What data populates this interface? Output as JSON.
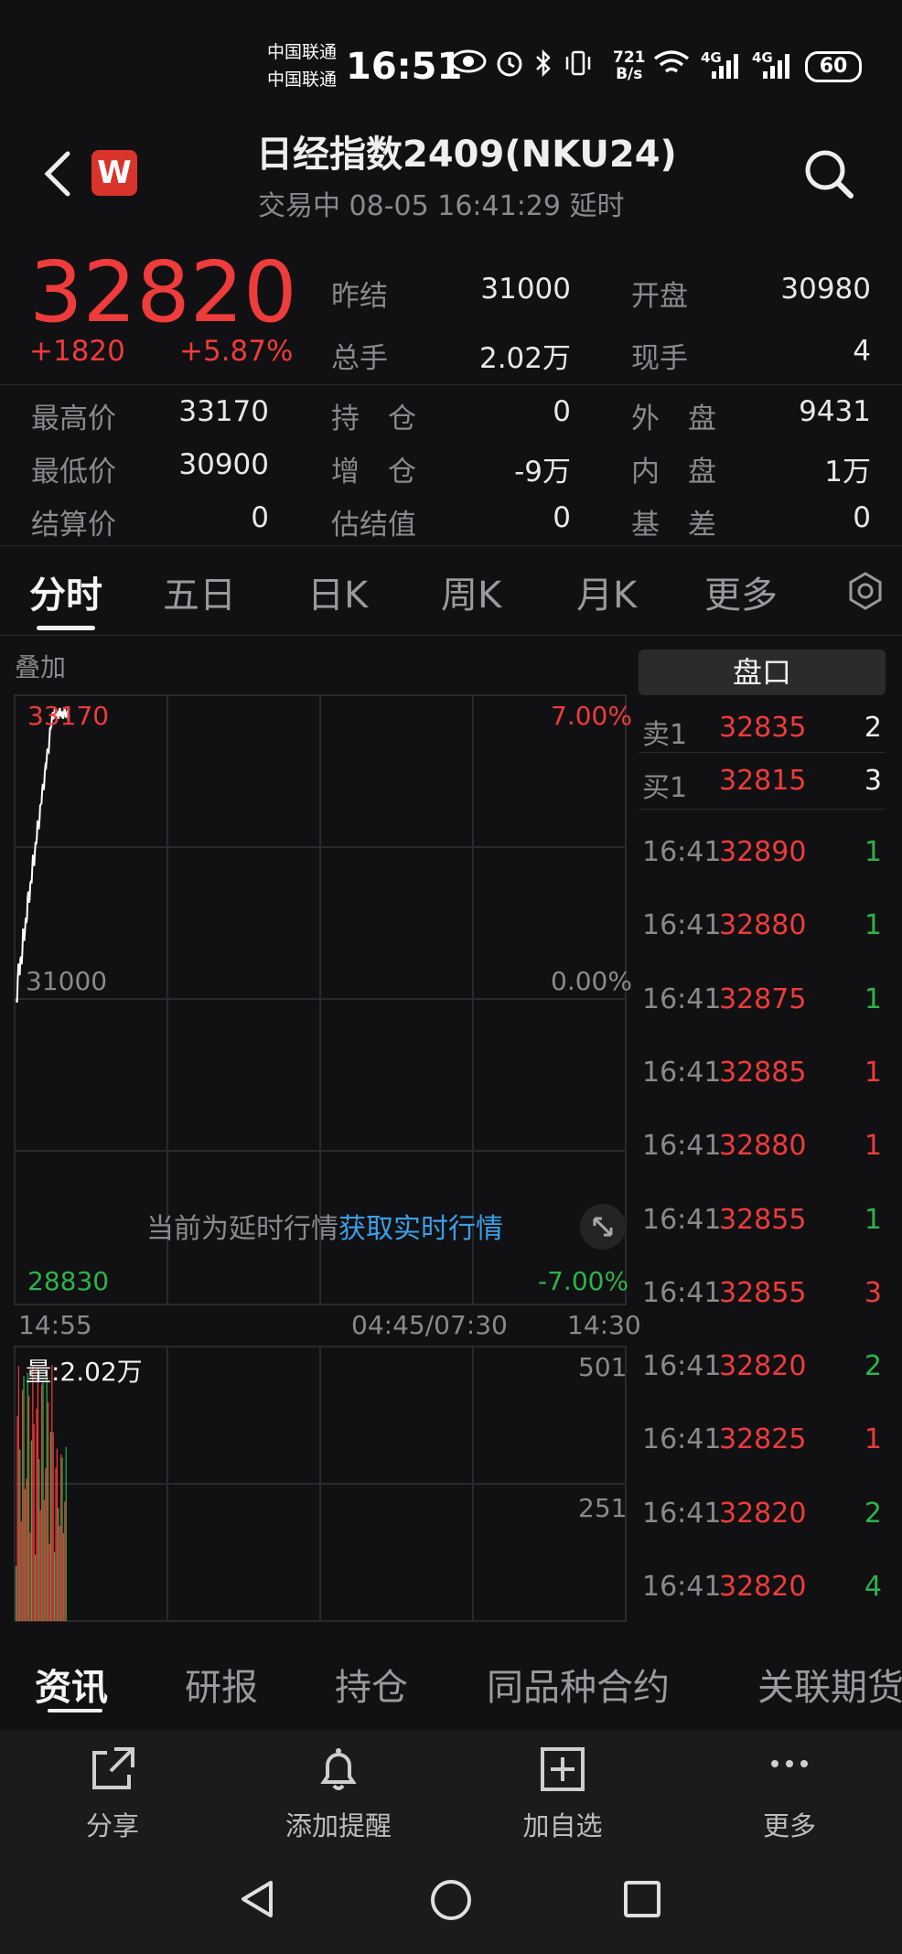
{
  "status_bar": {
    "carrier1": "中国联通",
    "carrier2": "中国联通",
    "time": "16:51",
    "net_speed_top": "721",
    "net_speed_bottom": "B/s",
    "sig1": "4G",
    "sig2": "4G",
    "battery": "60"
  },
  "header": {
    "title": "日经指数2409(NKU24)",
    "subtitle": "交易中 08-05 16:41:29 延时",
    "logo": "W"
  },
  "quote": {
    "price": "32820",
    "change": "+1820",
    "change_pct": "+5.87%",
    "fields": [
      {
        "label": "昨结",
        "value": "31000"
      },
      {
        "label": "开盘",
        "value": "30980"
      },
      {
        "label": "总手",
        "value": "2.02万"
      },
      {
        "label": "现手",
        "value": "4"
      },
      {
        "label": "最高价",
        "value": "33170"
      },
      {
        "label": "持　仓",
        "value": "0"
      },
      {
        "label": "外　盘",
        "value": "9431"
      },
      {
        "label": "最低价",
        "value": "30900"
      },
      {
        "label": "增　仓",
        "value": "-9万"
      },
      {
        "label": "内　盘",
        "value": "1万"
      },
      {
        "label": "结算价",
        "value": "0"
      },
      {
        "label": "估结值",
        "value": "0"
      },
      {
        "label": "基　差",
        "value": "0"
      }
    ]
  },
  "tabs": [
    "分时",
    "五日",
    "日K",
    "周K",
    "月K",
    "更多"
  ],
  "chart": {
    "overlay_label": "叠加",
    "y_top": "33170",
    "y_mid": "31000",
    "y_bottom": "28830",
    "pct_top": "7.00%",
    "pct_mid": "0.00%",
    "pct_bottom": "-7.00%",
    "x_start": "14:55",
    "x_mid": "04:45/07:30",
    "x_end": "14:30",
    "notice_text": "当前为延时行情",
    "notice_link": "获取实时行情",
    "volume_label": "量:2.02万",
    "vol_top": "501",
    "vol_mid": "251",
    "colors": {
      "up": "#ee3b3b",
      "down": "#2fb34a",
      "line": "#ffffff"
    }
  },
  "chart_data": {
    "type": "line",
    "x": [
      "14:55",
      "04:45/07:30",
      "14:30"
    ],
    "ylim": [
      28830,
      33170
    ],
    "series": [],
    "volume_ylim": [
      0,
      501
    ]
  },
  "order_book": {
    "title": "盘口",
    "ask": {
      "label": "卖1",
      "price": "32835",
      "qty": "2"
    },
    "bid": {
      "label": "买1",
      "price": "32815",
      "qty": "3"
    },
    "ticks": [
      {
        "time": "16:41",
        "price": "32890",
        "qty": "1",
        "dir": "green"
      },
      {
        "time": "16:41",
        "price": "32880",
        "qty": "1",
        "dir": "green"
      },
      {
        "time": "16:41",
        "price": "32875",
        "qty": "1",
        "dir": "green"
      },
      {
        "time": "16:41",
        "price": "32885",
        "qty": "1",
        "dir": "red"
      },
      {
        "time": "16:41",
        "price": "32880",
        "qty": "1",
        "dir": "red"
      },
      {
        "time": "16:41",
        "price": "32855",
        "qty": "1",
        "dir": "green"
      },
      {
        "time": "16:41",
        "price": "32855",
        "qty": "3",
        "dir": "red"
      },
      {
        "time": "16:41",
        "price": "32820",
        "qty": "2",
        "dir": "green"
      },
      {
        "time": "16:41",
        "price": "32825",
        "qty": "1",
        "dir": "red"
      },
      {
        "time": "16:41",
        "price": "32820",
        "qty": "2",
        "dir": "green"
      },
      {
        "time": "16:41",
        "price": "32820",
        "qty": "4",
        "dir": "green"
      }
    ]
  },
  "bottom_tabs": [
    "资讯",
    "研报",
    "持仓",
    "同品种合约",
    "关联期货"
  ],
  "actions": [
    {
      "label": "分享",
      "icon": "share-icon"
    },
    {
      "label": "添加提醒",
      "icon": "bell-icon"
    },
    {
      "label": "加自选",
      "icon": "add-watchlist-icon"
    },
    {
      "label": "更多",
      "icon": "more-icon"
    }
  ]
}
